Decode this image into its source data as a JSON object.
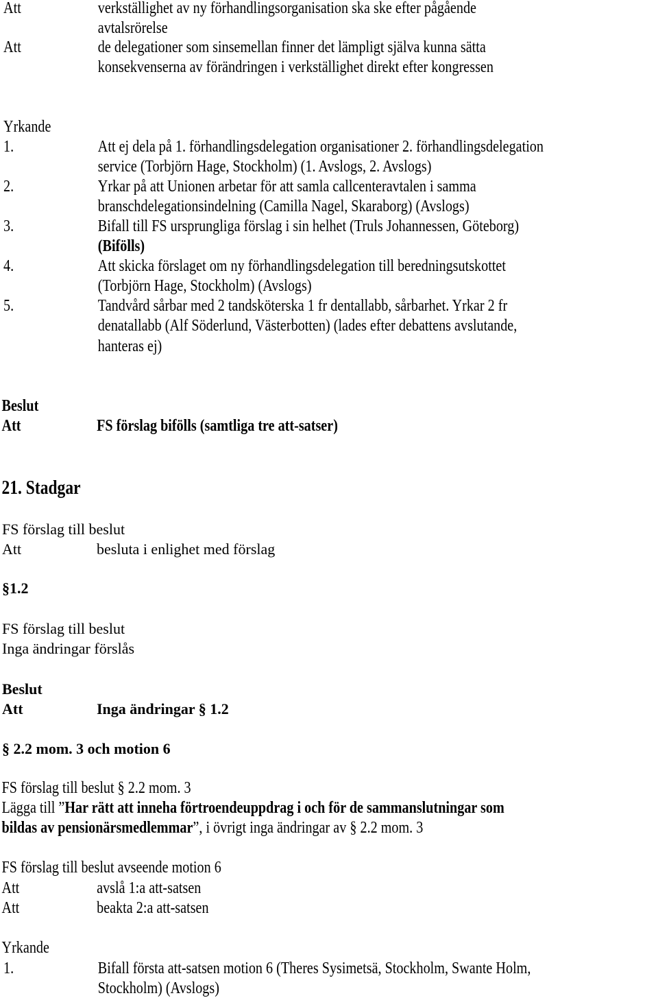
{
  "top_atts": [
    {
      "label": "Att",
      "lines": [
        "verkställighet av ny förhandlingsorganisation ska ske efter pågående",
        "avtalsrörelse"
      ]
    },
    {
      "label": "Att",
      "lines": [
        "de delegationer som sinsemellan finner det lämpligt själva kunna sätta",
        "konsekvenserna av förändringen i verkställighet direkt efter kongressen"
      ]
    }
  ],
  "yrkande1": {
    "heading": "Yrkande",
    "items": [
      {
        "num": "1.",
        "lines": [
          "Att ej dela på 1. förhandlingsdelegation organisationer 2. förhandlingsdelegation",
          "service (Torbjörn Hage, Stockholm) (1. Avslogs, 2. Avslogs)"
        ]
      },
      {
        "num": "2.",
        "lines": [
          "Yrkar på att Unionen arbetar för att samla callcenteravtalen i samma",
          "branschdelegationsindelning (Camilla Nagel, Skaraborg) (Avslogs)"
        ]
      },
      {
        "num": "3.",
        "lines": [
          "Bifall till FS ursprungliga förslag i sin helhet (Truls Johannessen, Göteborg)",
          "(Bifölls)"
        ]
      },
      {
        "num": "4.",
        "lines": [
          "Att skicka förslaget om ny förhandlingsdelegation till beredningsutskottet",
          "(Torbjörn Hage, Stockholm) (Avslogs)"
        ]
      },
      {
        "num": "5.",
        "lines": [
          "Tandvård sårbar med 2 tandsköterska 1 fr dentallabb, sårbarhet. Yrkar 2 fr",
          "denatallabb (Alf Söderlund, Västerbotten) (lades efter debattens avslutande,",
          "hanteras ej)"
        ]
      }
    ]
  },
  "beslut1": {
    "heading": "Beslut",
    "label": "Att",
    "text": "FS förslag bifölls (samtliga tre att-satser)"
  },
  "section21": {
    "title": "21. Stadgar",
    "fs_heading": "FS förslag till beslut",
    "att_label": "Att",
    "att_text": "besluta i enlighet med förslag"
  },
  "par12": {
    "title": "§1.2",
    "fs_heading": "FS förslag till beslut",
    "fs_text": "Inga ändringar förslås",
    "beslut_heading": "Beslut",
    "beslut_label": "Att",
    "beslut_text": "Inga ändringar § 1.2"
  },
  "par22": {
    "title": "§ 2.2 mom. 3 och motion 6",
    "fs_heading": "FS förslag till beslut § 2.2 mom. 3",
    "add_prefix": "Lägga till ”",
    "add_bold_1": "Har rätt att inneha förtroendeuppdrag i och för de sammanslutningar som",
    "add_bold_2": "bildas av pensionärsmedlemmar",
    "add_suffix": "”, i övrigt inga ändringar av § 2.2 mom. 3",
    "motion_heading": "FS förslag till beslut avseende motion 6",
    "motion_atts": [
      {
        "label": "Att",
        "text": "avslå 1:a att-satsen"
      },
      {
        "label": "Att",
        "text": "beakta 2:a att-satsen"
      }
    ]
  },
  "yrkande2": {
    "heading": "Yrkande",
    "items": [
      {
        "num": "1.",
        "lines": [
          "Bifall första att-satsen motion 6 (Theres Sysimetsä, Stockholm, Swante Holm,",
          "Stockholm) (Avslogs)"
        ]
      }
    ]
  }
}
